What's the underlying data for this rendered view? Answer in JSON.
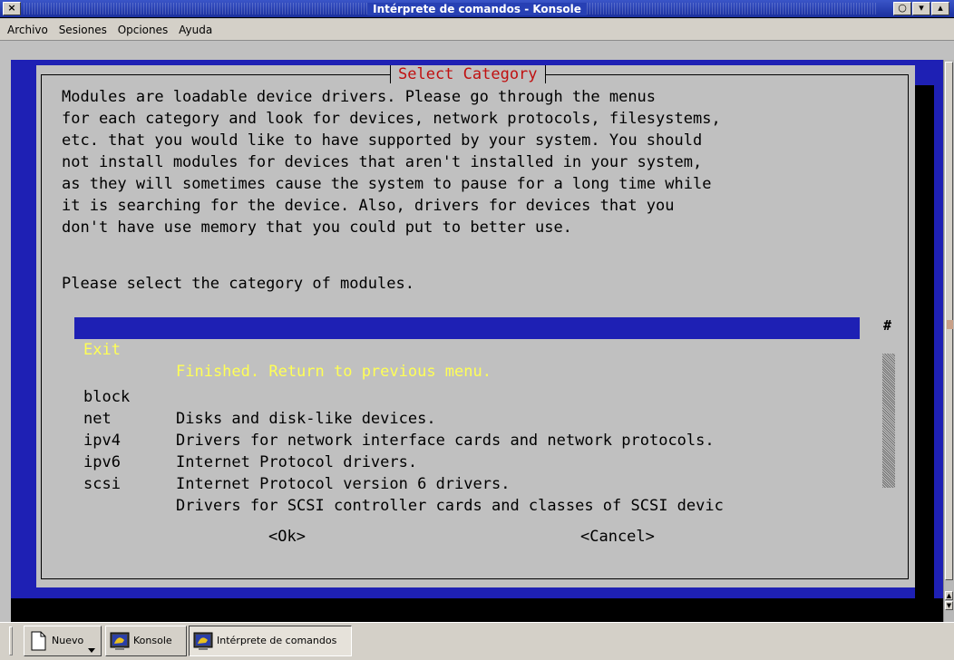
{
  "window": {
    "title": "Intérprete de comandos - Konsole",
    "close_glyph": "×",
    "buttons": [
      "○",
      "▾",
      "▴"
    ]
  },
  "menubar": {
    "items": [
      "Archivo",
      "Sesiones",
      "Opciones",
      "Ayuda"
    ]
  },
  "dialog": {
    "title": "Select Category",
    "description_lines": [
      "Modules are loadable device drivers. Please go through the menus",
      "for each category and look for devices, network protocols, filesystems,",
      "etc. that you would like to have supported by your system. You should",
      "not install modules for devices that aren't installed in your system,",
      "as they will sometimes cause the system to pause for a long time while",
      "it is searching for the device. Also, drivers for devices that you",
      "don't have use memory that you could put to better use."
    ],
    "prompt": "Please select the category of modules.",
    "menu": [
      {
        "key": "Exit",
        "desc": "Finished. Return to previous menu.",
        "selected": true
      },
      {
        "key": "block",
        "desc": "Disks and disk-like devices.",
        "selected": false
      },
      {
        "key": "net",
        "desc": "Drivers for network interface cards and network protocols.",
        "selected": false
      },
      {
        "key": "ipv4",
        "desc": "Internet Protocol drivers.",
        "selected": false
      },
      {
        "key": "ipv6",
        "desc": "Internet Protocol version 6 drivers.",
        "selected": false
      },
      {
        "key": "scsi",
        "desc": "Drivers for SCSI controller cards and classes of SCSI devic",
        "selected": false
      }
    ],
    "scroll_marker": "#",
    "ok_label": "<Ok>",
    "cancel_label": "<Cancel>"
  },
  "taskbar": {
    "buttons": [
      {
        "label": "Nuevo",
        "icon": "new-document-icon",
        "active": false
      },
      {
        "label": "Konsole",
        "icon": "konsole-icon",
        "active": false
      },
      {
        "label": "Intérprete de comandos",
        "icon": "konsole-icon",
        "active": true
      }
    ]
  },
  "colors": {
    "terminal_bg": "#1e20b4",
    "dialog_bg": "#c0c0c0",
    "dialog_title": "#c01010",
    "selected_text": "#ffff55"
  }
}
